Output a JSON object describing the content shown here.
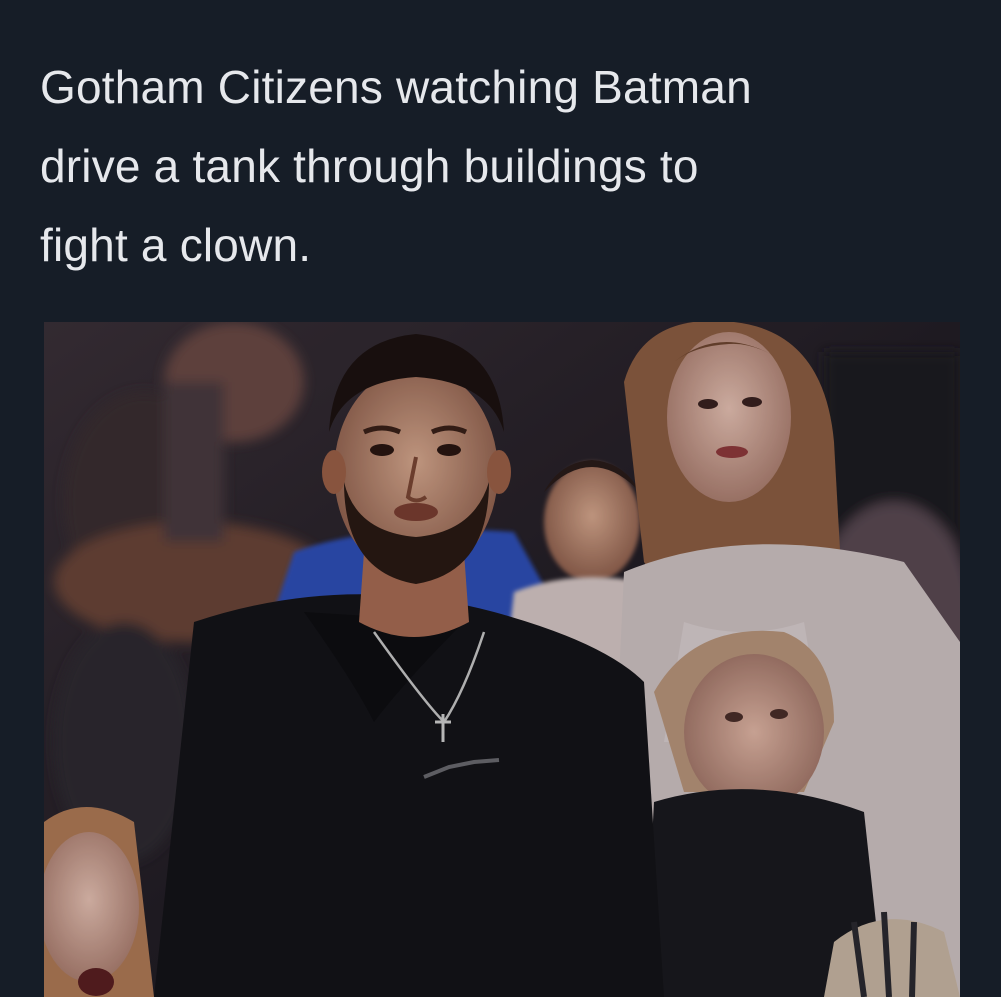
{
  "caption": {
    "lines": [
      "Gotham Citizens watching Batman",
      "drive a tank through buildings to",
      "fight a clown."
    ]
  },
  "photo": {
    "description_icon": "crowd-reaction-photo"
  },
  "colors": {
    "background": "#161d27",
    "caption_text": "#e6e8ec"
  }
}
